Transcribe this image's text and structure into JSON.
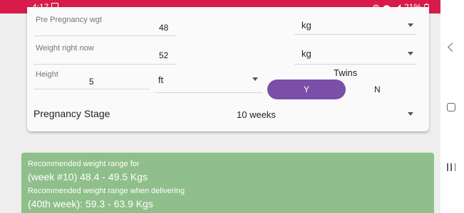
{
  "status_bar": {
    "time": "4:17",
    "battery": "21%",
    "color": "#d81b4a"
  },
  "form": {
    "pre_pregnancy": {
      "label": "Pre Pregnancy wgt",
      "value": "48",
      "unit": "kg"
    },
    "weight_now": {
      "label": "Weight right now",
      "value": "52",
      "unit": "kg"
    },
    "height": {
      "label": "Height",
      "value": "5",
      "unit": "ft"
    },
    "twins": {
      "label": "Twins",
      "yes": "Y",
      "no": "N",
      "selected": "Y"
    },
    "stage": {
      "label": "Pregnancy Stage",
      "value": "10 weeks"
    }
  },
  "result": {
    "line1": "Recommended weight range for",
    "line2": "(week #10) 48.4 - 49.5 Kgs",
    "line3": "Recommended weight range when delivering",
    "line4": "(40th week): 59.3 - 63.9 Kgs",
    "color": "#8fbf8a"
  },
  "icons": {
    "image": "image-icon",
    "hotspot": "hotspot-icon",
    "wifi": "wifi-icon",
    "signal": "signal-icon",
    "battery": "battery-icon",
    "back": "back-icon",
    "home": "home-icon",
    "recent": "recent-apps-icon",
    "dropdown": "chevron-down-icon"
  },
  "accent_color": "#7b4fa8"
}
